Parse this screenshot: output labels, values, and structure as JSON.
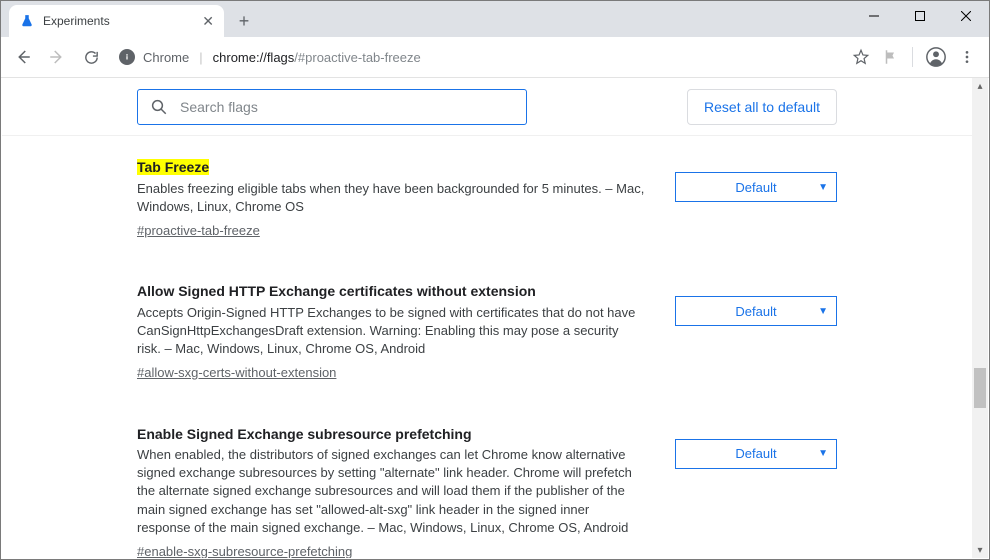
{
  "window": {
    "tab_title": "Experiments"
  },
  "omnibox": {
    "host": "Chrome",
    "path_strong": "chrome://flags",
    "path_weak": "/#proactive-tab-freeze"
  },
  "search": {
    "placeholder": "Search flags"
  },
  "reset_label": "Reset all to default",
  "flags": [
    {
      "title": "Tab Freeze",
      "highlight": true,
      "description": "Enables freezing eligible tabs when they have been backgrounded for 5 minutes. – Mac, Windows, Linux, Chrome OS",
      "link": "#proactive-tab-freeze",
      "select": "Default"
    },
    {
      "title": "Allow Signed HTTP Exchange certificates without extension",
      "highlight": false,
      "description": "Accepts Origin-Signed HTTP Exchanges to be signed with certificates that do not have CanSignHttpExchangesDraft extension. Warning: Enabling this may pose a security risk. – Mac, Windows, Linux, Chrome OS, Android",
      "link": "#allow-sxg-certs-without-extension",
      "select": "Default"
    },
    {
      "title": "Enable Signed Exchange subresource prefetching",
      "highlight": false,
      "description": "When enabled, the distributors of signed exchanges can let Chrome know alternative signed exchange subresources by setting \"alternate\" link header. Chrome will prefetch the alternate signed exchange subresources and will load them if the publisher of the main signed exchange has set \"allowed-alt-sxg\" link header in the signed inner response of the main signed exchange. – Mac, Windows, Linux, Chrome OS, Android",
      "link": "#enable-sxg-subresource-prefetching",
      "select": "Default"
    }
  ]
}
